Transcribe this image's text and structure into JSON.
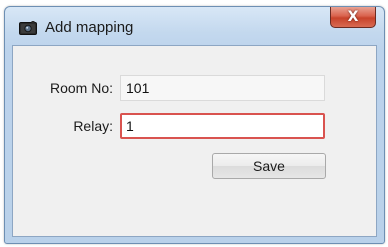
{
  "window": {
    "title": "Add mapping",
    "app_icon": "app-camera-icon",
    "close_glyph": "X"
  },
  "form": {
    "room_label": "Room No:",
    "room_value": "101",
    "relay_label": "Relay:",
    "relay_value": "1",
    "save_label": "Save"
  },
  "colors": {
    "relay_invalid_border": "#d9534f",
    "close_button": "#c8432b"
  }
}
